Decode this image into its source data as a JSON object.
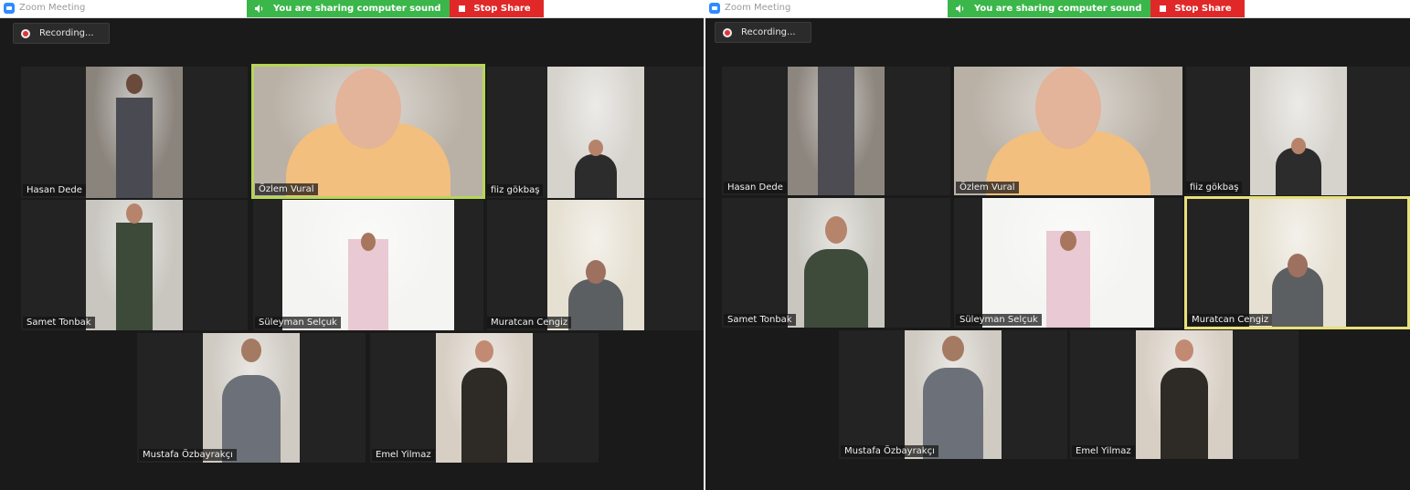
{
  "app": {
    "title": "Zoom Meeting"
  },
  "share_banner": {
    "sharing_text": "You are sharing computer sound",
    "stop_label": "Stop Share"
  },
  "recording": {
    "label": "Recording..."
  },
  "left": {
    "participants": [
      {
        "name": "Hasan Dede"
      },
      {
        "name": "Özlem Vural"
      },
      {
        "name": "fiiz gökbaş"
      },
      {
        "name": "Samet Tonbak"
      },
      {
        "name": "Süleyman Selçuk"
      },
      {
        "name": "Muratcan Cengiz"
      },
      {
        "name": "Mustafa Özbayrakçı"
      },
      {
        "name": "Emel Yilmaz"
      }
    ]
  },
  "right": {
    "participants": [
      {
        "name": "Hasan Dede"
      },
      {
        "name": "Özlem Vural"
      },
      {
        "name": "fiiz gökbaş"
      },
      {
        "name": "Samet Tonbak"
      },
      {
        "name": "Süleyman Selçuk"
      },
      {
        "name": "Muratcan Cengiz"
      },
      {
        "name": "Mustafa Özbayrakçı"
      },
      {
        "name": "Emel Yilmaz"
      }
    ]
  },
  "colors": {
    "active_speaker_left": "#b6d657",
    "active_speaker_right": "#e8e07a",
    "share_green": "#3bb64a",
    "share_red": "#e02828"
  }
}
